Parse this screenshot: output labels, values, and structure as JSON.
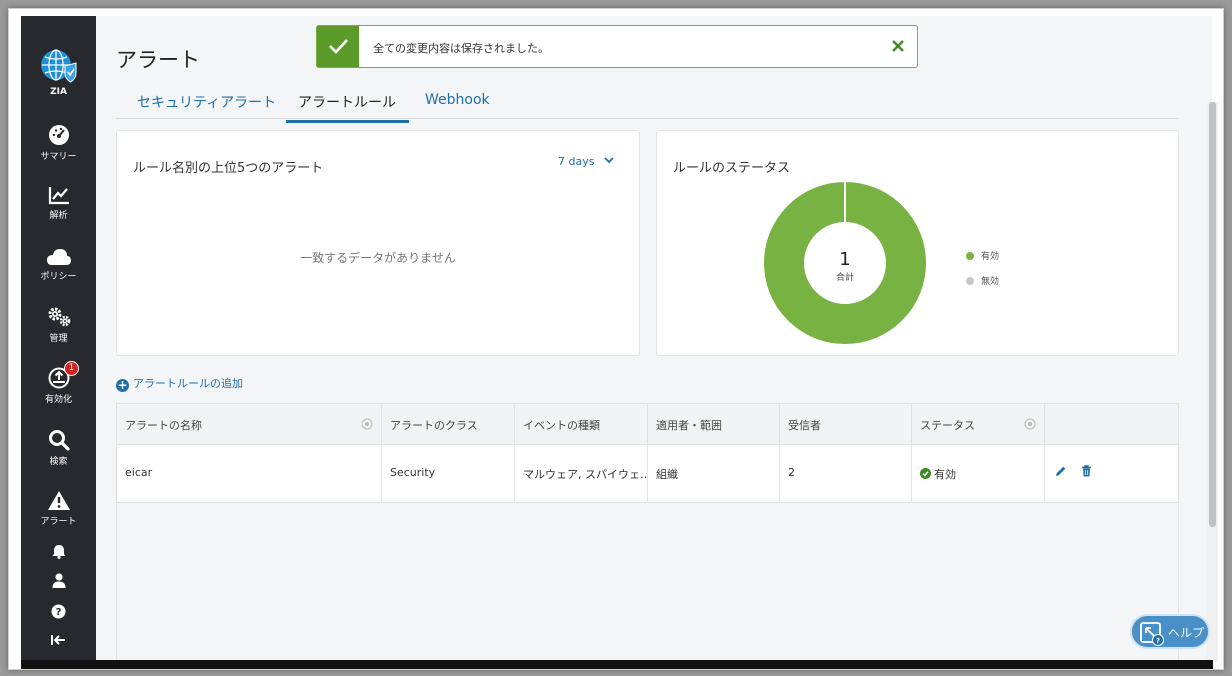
{
  "sidebar": {
    "brand": "ZIA",
    "items": [
      {
        "label": "サマリー",
        "icon": "dashboard-icon"
      },
      {
        "label": "解析",
        "icon": "analytics-icon"
      },
      {
        "label": "ポリシー",
        "icon": "cloud-icon"
      },
      {
        "label": "管理",
        "icon": "gears-icon"
      },
      {
        "label": "有効化",
        "icon": "activation-icon",
        "badge": "1"
      },
      {
        "label": "検索",
        "icon": "search-icon"
      },
      {
        "label": "アラート",
        "icon": "alert-icon"
      }
    ]
  },
  "page": {
    "title": "アラート"
  },
  "toast": {
    "message": "全ての変更内容は保存されました。"
  },
  "tabs": [
    {
      "label": "セキュリティアラート",
      "active": false
    },
    {
      "label": "アラートルール",
      "active": true
    },
    {
      "label": "Webhook",
      "active": false
    }
  ],
  "top_alerts_card": {
    "title": "ルール名別の上位5つのアラート",
    "period": "7 days",
    "empty_message": "一致するデータがありません"
  },
  "status_card": {
    "title": "ルールのステータス",
    "total_value": "1",
    "total_label": "合計",
    "legend": [
      {
        "label": "有効",
        "color": "#77b243"
      },
      {
        "label": "無効",
        "color": "#c8c8c8"
      }
    ]
  },
  "chart_data": {
    "type": "pie",
    "categories": [
      "有効",
      "無効"
    ],
    "values": [
      1,
      0
    ],
    "title": "ルールのステータス"
  },
  "add_rule_label": "アラートルールの追加",
  "table": {
    "columns": [
      "アラートの名称",
      "アラートのクラス",
      "イベントの種類",
      "適用者・範囲",
      "受信者",
      "ステータス"
    ],
    "rows": [
      {
        "name": "eicar",
        "class": "Security",
        "event_type": "マルウェア, スパイウェ…",
        "scope": "組織",
        "recipients": "2",
        "status": "有効"
      }
    ]
  },
  "help_button": {
    "label": "ヘルプ"
  },
  "colors": {
    "accent": "#1f6fa8",
    "success": "#5a9b2a",
    "enabled": "#77b243",
    "sidebar_bg": "#27292e"
  }
}
